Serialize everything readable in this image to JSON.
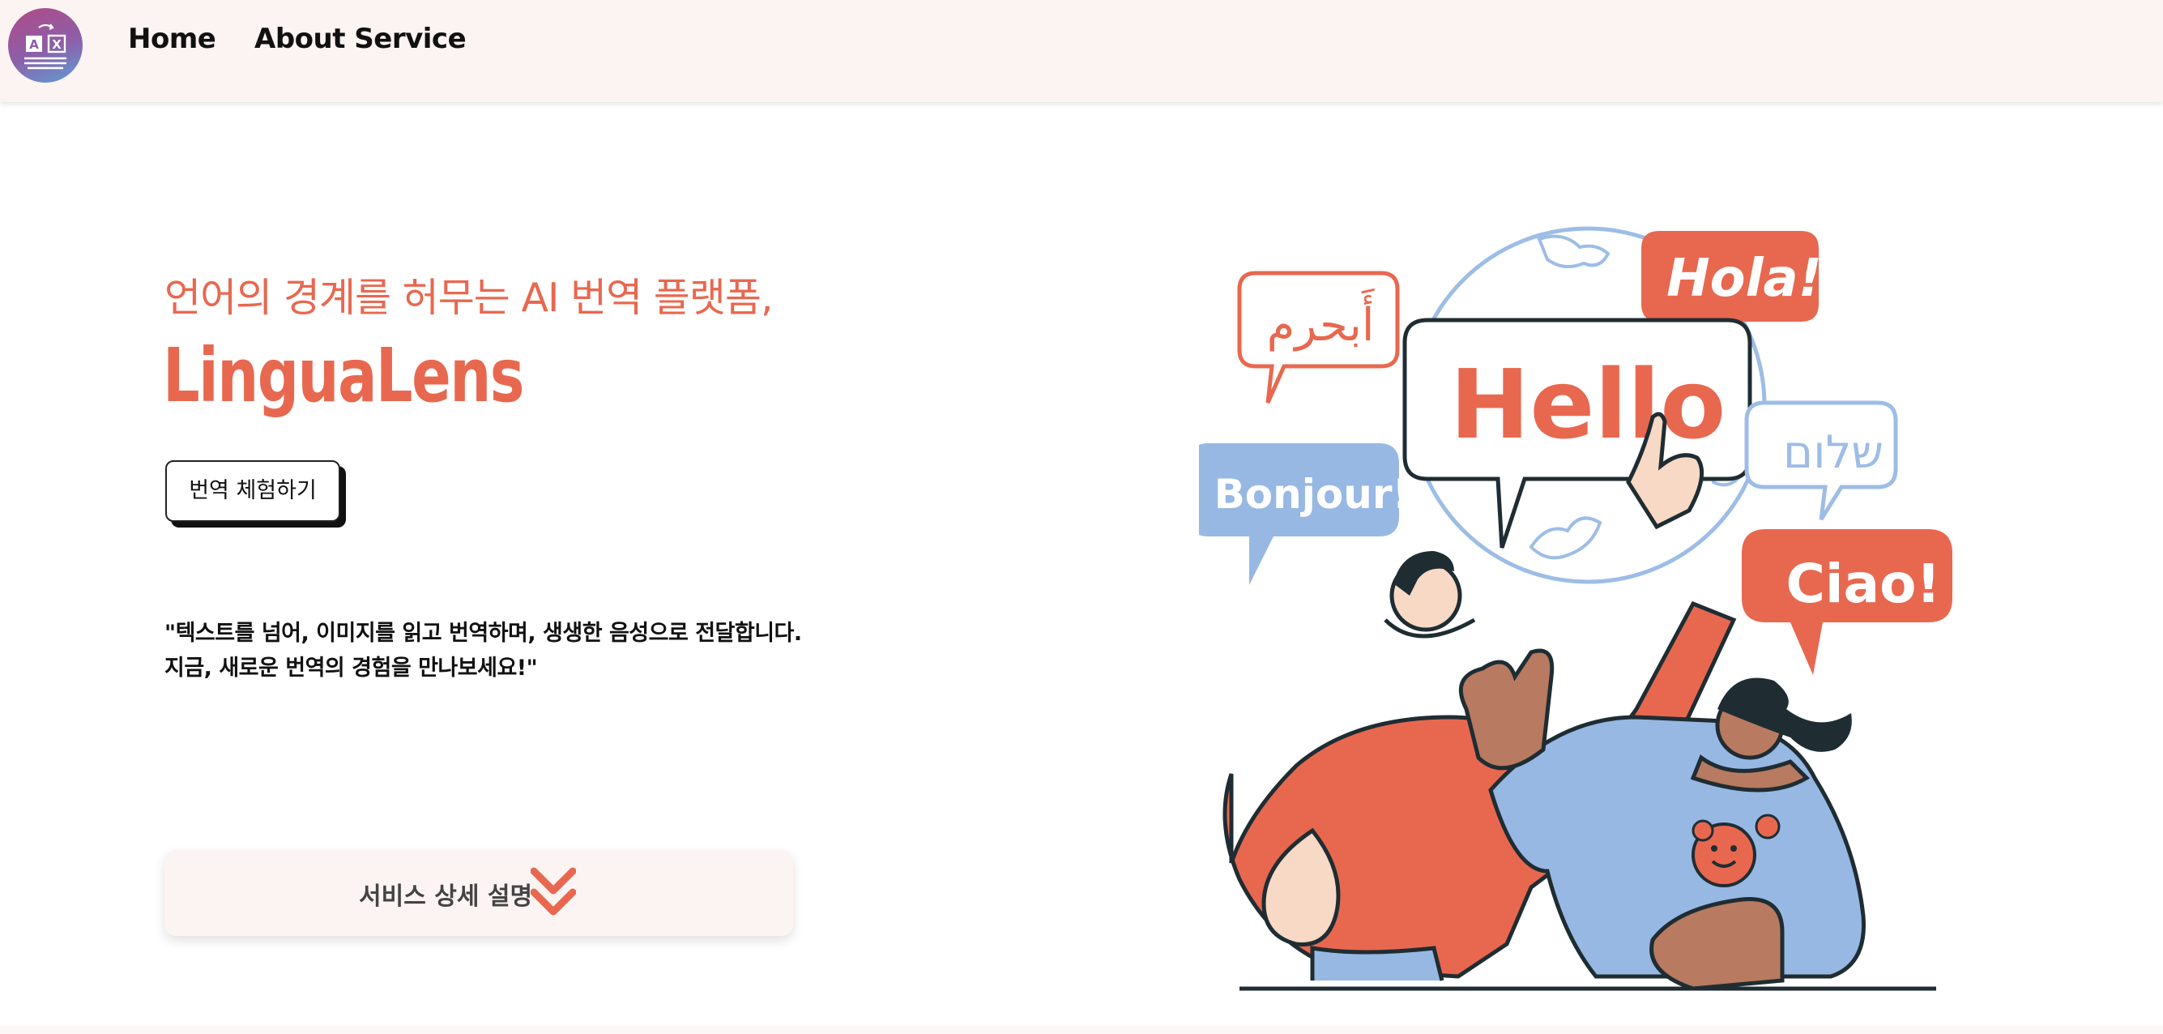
{
  "nav": {
    "home_label": "Home",
    "about_label": "About Service"
  },
  "logo": {
    "icon": "translate-icon",
    "letters": [
      "A",
      "X"
    ]
  },
  "hero": {
    "tagline": "언어의 경계를 허무는 AI 번역 플랫폼,",
    "brand": "LinguaLens",
    "try_button_label": "번역 체험하기",
    "quote_line1": "\"텍스트를 넘어, 이미지를 읽고 번역하며, 생생한 음성으로 전달합니다.",
    "quote_line2": "지금, 새로운 번역의 경험을 만나보세요!\"",
    "detail_button_label": "서비스 상세 설명",
    "detail_icon": "double-chevron-down-icon"
  },
  "illustration": {
    "greetings": {
      "arabic": "أَبحرم",
      "spanish": "Hola!",
      "english": "Hello",
      "hebrew": "שלום",
      "french": "Bonjour!",
      "italian": "Ciao!"
    }
  },
  "colors": {
    "accent": "#e8684f",
    "header_bg": "#fcf4f3",
    "blue": "#97b8e3",
    "dark": "#1f2d33",
    "skin_light": "#f8d9c5",
    "skin_dark": "#b87a60"
  }
}
